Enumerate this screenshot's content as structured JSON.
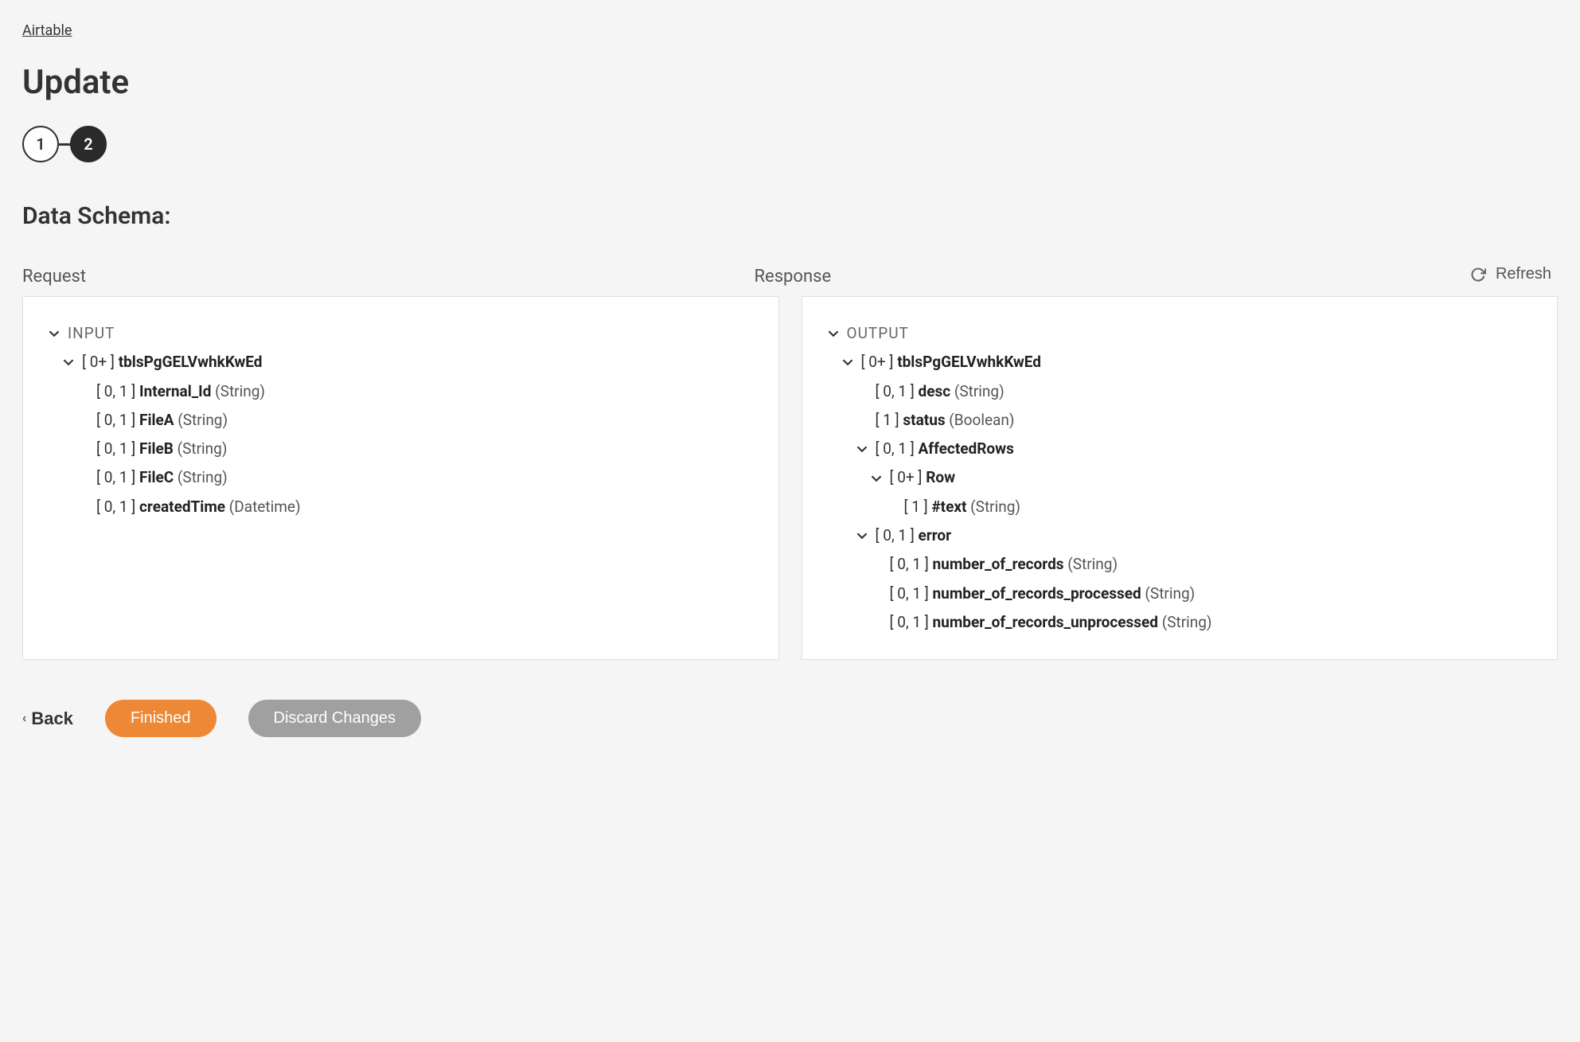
{
  "breadcrumb": "Airtable",
  "title": "Update",
  "stepper": {
    "step1": "1",
    "step2": "2"
  },
  "sectionHeading": "Data Schema:",
  "labels": {
    "request": "Request",
    "response": "Response",
    "refresh": "Refresh"
  },
  "request": {
    "root": "INPUT",
    "table": {
      "cardinality": "[ 0+ ]",
      "name": "tblsPgGELVwhkKwEd"
    },
    "fields": [
      {
        "cardinality": "[ 0, 1 ]",
        "name": "Internal_Id",
        "type": "(String)"
      },
      {
        "cardinality": "[ 0, 1 ]",
        "name": "FileA",
        "type": "(String)"
      },
      {
        "cardinality": "[ 0, 1 ]",
        "name": "FileB",
        "type": "(String)"
      },
      {
        "cardinality": "[ 0, 1 ]",
        "name": "FileC",
        "type": "(String)"
      },
      {
        "cardinality": "[ 0, 1 ]",
        "name": "createdTime",
        "type": "(Datetime)"
      }
    ]
  },
  "response": {
    "root": "OUTPUT",
    "table": {
      "cardinality": "[ 0+ ]",
      "name": "tblsPgGELVwhkKwEd"
    },
    "tableFields": [
      {
        "cardinality": "[ 0, 1 ]",
        "name": "desc",
        "type": "(String)"
      },
      {
        "cardinality": "[ 1 ]",
        "name": "status",
        "type": "(Boolean)"
      }
    ],
    "affectedRows": {
      "cardinality": "[ 0, 1 ]",
      "name": "AffectedRows"
    },
    "row": {
      "cardinality": "[ 0+ ]",
      "name": "Row"
    },
    "rowFields": [
      {
        "cardinality": "[ 1 ]",
        "name": "#text",
        "type": "(String)"
      }
    ],
    "error": {
      "cardinality": "[ 0, 1 ]",
      "name": "error"
    },
    "errorFields": [
      {
        "cardinality": "[ 0, 1 ]",
        "name": "number_of_records",
        "type": "(String)"
      },
      {
        "cardinality": "[ 0, 1 ]",
        "name": "number_of_records_processed",
        "type": "(String)"
      },
      {
        "cardinality": "[ 0, 1 ]",
        "name": "number_of_records_unprocessed",
        "type": "(String)"
      }
    ]
  },
  "footer": {
    "back": "Back",
    "finished": "Finished",
    "discard": "Discard Changes"
  }
}
